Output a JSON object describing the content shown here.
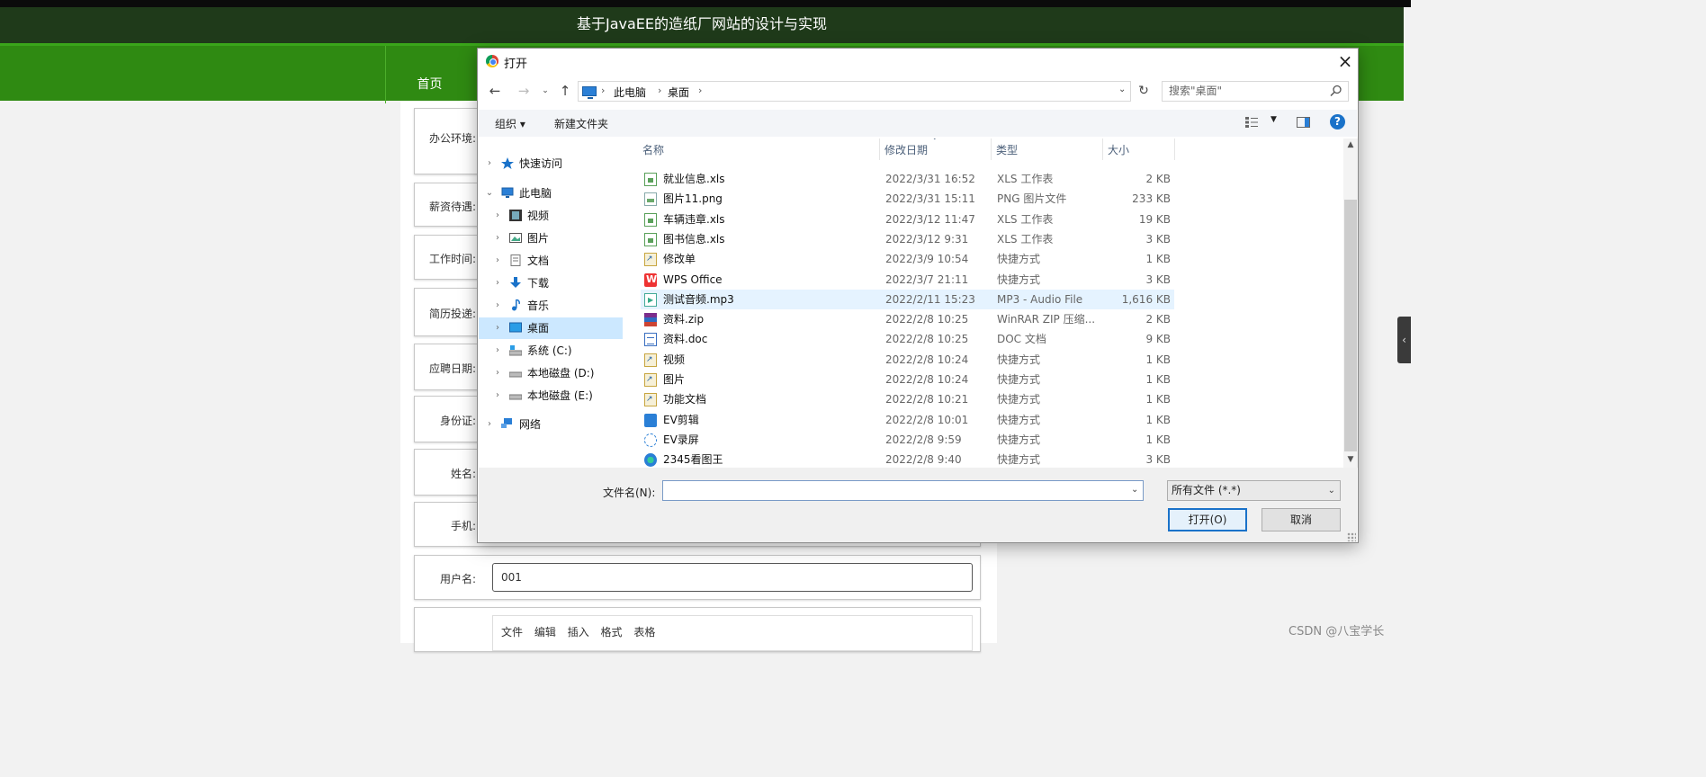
{
  "page": {
    "title": "基于JavaEE的造纸厂网站的设计与实现",
    "nav_home": "首页",
    "fields": [
      {
        "label": "办公环境:"
      },
      {
        "label": "薪资待遇:"
      },
      {
        "label": "工作时间:"
      },
      {
        "label": "简历投递:"
      },
      {
        "label": "应聘日期:"
      },
      {
        "label": "身份证:"
      },
      {
        "label": "姓名:"
      },
      {
        "label": "手机:"
      },
      {
        "label": "用户名:",
        "value": "001"
      }
    ],
    "editor_menu": [
      "文件",
      "编辑",
      "插入",
      "格式",
      "表格"
    ],
    "watermark": "CSDN @八宝学长"
  },
  "dialog": {
    "title": "打开",
    "breadcrumb": [
      "此电脑",
      "桌面"
    ],
    "search_placeholder": "搜索\"桌面\"",
    "toolbar": {
      "organize": "组织 ▾",
      "new_folder": "新建文件夹"
    },
    "nav_pane": [
      {
        "label": "快速访问",
        "icon": "star-icon"
      },
      {
        "label": "此电脑",
        "icon": "computer-icon",
        "expanded": true
      },
      {
        "label": "视频",
        "icon": "video-folder-icon"
      },
      {
        "label": "图片",
        "icon": "pictures-folder-icon"
      },
      {
        "label": "文档",
        "icon": "documents-folder-icon"
      },
      {
        "label": "下载",
        "icon": "download-icon"
      },
      {
        "label": "音乐",
        "icon": "music-icon"
      },
      {
        "label": "桌面",
        "icon": "desktop-icon",
        "selected": true
      },
      {
        "label": "系统 (C:)",
        "icon": "drive-icon"
      },
      {
        "label": "本地磁盘 (D:)",
        "icon": "drive-icon"
      },
      {
        "label": "本地磁盘 (E:)",
        "icon": "drive-icon"
      },
      {
        "label": "网络",
        "icon": "network-icon"
      }
    ],
    "columns": {
      "name": "名称",
      "date": "修改日期",
      "type": "类型",
      "size": "大小"
    },
    "files": [
      {
        "name": "就业信息.xls",
        "date": "2022/3/31 16:52",
        "type": "XLS 工作表",
        "size": "2 KB",
        "icon": "xls-icon"
      },
      {
        "name": "图片11.png",
        "date": "2022/3/31 15:11",
        "type": "PNG 图片文件",
        "size": "233 KB",
        "icon": "png-icon"
      },
      {
        "name": "车辆违章.xls",
        "date": "2022/3/12 11:47",
        "type": "XLS 工作表",
        "size": "19 KB",
        "icon": "xls-icon"
      },
      {
        "name": "图书信息.xls",
        "date": "2022/3/12 9:31",
        "type": "XLS 工作表",
        "size": "3 KB",
        "icon": "xls-icon"
      },
      {
        "name": "修改单",
        "date": "2022/3/9 10:54",
        "type": "快捷方式",
        "size": "1 KB",
        "icon": "shortcut-icon"
      },
      {
        "name": "WPS Office",
        "date": "2022/3/7 21:11",
        "type": "快捷方式",
        "size": "3 KB",
        "icon": "wps-icon"
      },
      {
        "name": "测试音频.mp3",
        "date": "2022/2/11 15:23",
        "type": "MP3 - Audio File",
        "size": "1,616 KB",
        "icon": "mp3-icon",
        "hover": true
      },
      {
        "name": "资料.zip",
        "date": "2022/2/8 10:25",
        "type": "WinRAR ZIP 压缩...",
        "size": "2 KB",
        "icon": "zip-icon"
      },
      {
        "name": "资料.doc",
        "date": "2022/2/8 10:25",
        "type": "DOC 文档",
        "size": "9 KB",
        "icon": "doc-icon"
      },
      {
        "name": "视频",
        "date": "2022/2/8 10:24",
        "type": "快捷方式",
        "size": "1 KB",
        "icon": "shortcut-icon"
      },
      {
        "name": "图片",
        "date": "2022/2/8 10:24",
        "type": "快捷方式",
        "size": "1 KB",
        "icon": "shortcut-icon"
      },
      {
        "name": "功能文档",
        "date": "2022/2/8 10:21",
        "type": "快捷方式",
        "size": "1 KB",
        "icon": "shortcut-icon"
      },
      {
        "name": "EV剪辑",
        "date": "2022/2/8 10:01",
        "type": "快捷方式",
        "size": "1 KB",
        "icon": "ev-edit-icon"
      },
      {
        "name": "EV录屏",
        "date": "2022/2/8 9:59",
        "type": "快捷方式",
        "size": "1 KB",
        "icon": "ev-record-icon"
      },
      {
        "name": "2345看图王",
        "date": "2022/2/8 9:40",
        "type": "快捷方式",
        "size": "3 KB",
        "icon": "image-viewer-icon"
      }
    ],
    "filename_label": "文件名(N):",
    "filename_value": "",
    "filetype": "所有文件 (*.*)",
    "open_button": "打开(O)",
    "cancel_button": "取消"
  }
}
